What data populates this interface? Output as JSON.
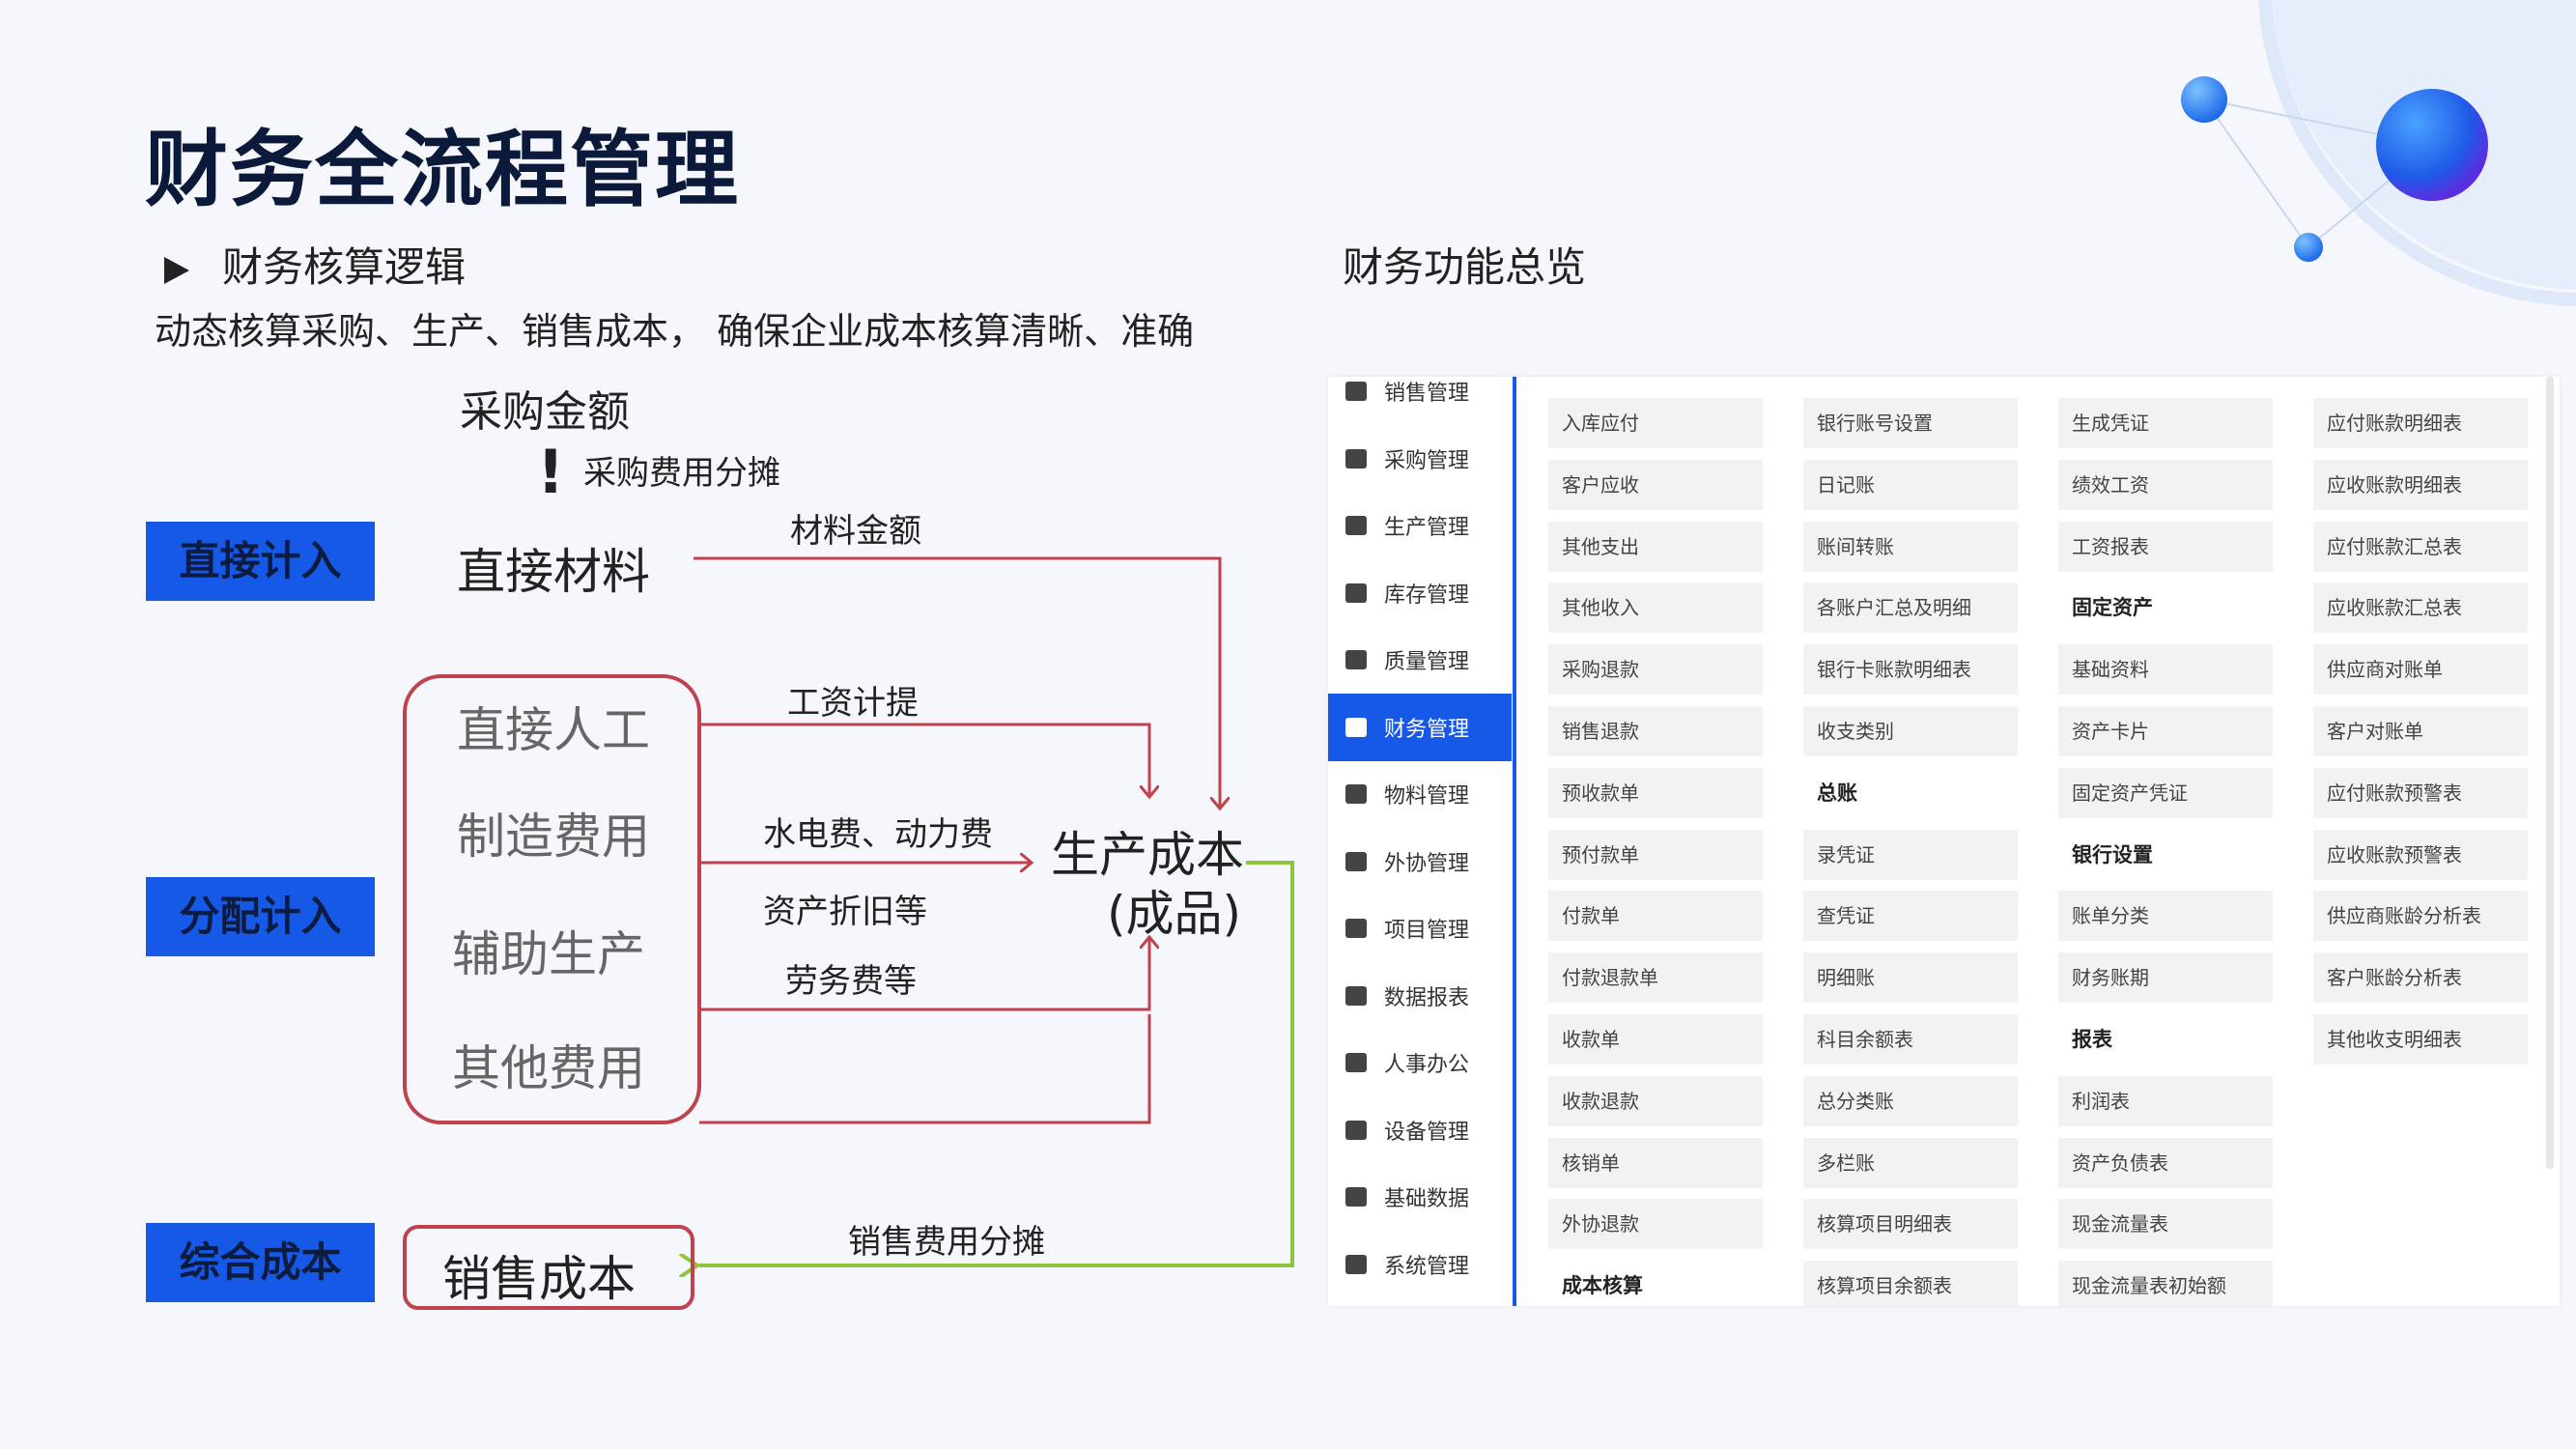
{
  "title": "财务全流程管理",
  "section_left": {
    "heading": "财务核算逻辑",
    "description": "动态核算采购、生产、销售成本， 确保企业成本核算清晰、准确"
  },
  "section_right": {
    "heading": "财务功能总览"
  },
  "diagram": {
    "tags": {
      "direct": "直接计入",
      "allocated": "分配计入",
      "comprehensive": "综合成本"
    },
    "purchase_amount": "采购金额",
    "exclamation": "!",
    "purchase_allocation": "采购费用分摊",
    "direct_material": "直接材料",
    "material_amount": "材料金额",
    "group_items": [
      "直接人工",
      "制造费用",
      "辅助生产",
      "其他费用"
    ],
    "wage": "工资计提",
    "utilities": "水电费、动力费",
    "depreciation": "资产折旧等",
    "labor": "劳务费等",
    "production_cost": "生产成本",
    "finished": "(成品)",
    "sales_allocation": "销售费用分摊",
    "sales_cost": "销售成本",
    "colors": {
      "red": "#c0424d",
      "green": "#8cc63f",
      "blue": "#1659e6"
    }
  },
  "ui_panel": {
    "sidebar": [
      {
        "label": "销售管理",
        "icon": "bar-chart-icon"
      },
      {
        "label": "采购管理",
        "icon": "edit-icon"
      },
      {
        "label": "生产管理",
        "icon": "cube-icon"
      },
      {
        "label": "库存管理",
        "icon": "box-icon"
      },
      {
        "label": "质量管理",
        "icon": "quality-icon"
      },
      {
        "label": "财务管理",
        "icon": "finance-icon",
        "active": true
      },
      {
        "label": "物料管理",
        "icon": "layers-icon"
      },
      {
        "label": "外协管理",
        "icon": "briefcase-icon"
      },
      {
        "label": "项目管理",
        "icon": "folder-icon"
      },
      {
        "label": "数据报表",
        "icon": "report-icon"
      },
      {
        "label": "人事办公",
        "icon": "person-icon"
      },
      {
        "label": "设备管理",
        "icon": "device-icon"
      },
      {
        "label": "基础数据",
        "icon": "database-icon"
      },
      {
        "label": "系统管理",
        "icon": "monitor-icon"
      }
    ],
    "columns": [
      [
        {
          "t": "入库应付"
        },
        {
          "t": "客户应收"
        },
        {
          "t": "其他支出"
        },
        {
          "t": "其他收入"
        },
        {
          "t": "采购退款"
        },
        {
          "t": "销售退款"
        },
        {
          "t": "预收款单"
        },
        {
          "t": "预付款单"
        },
        {
          "t": "付款单"
        },
        {
          "t": "付款退款单"
        },
        {
          "t": "收款单"
        },
        {
          "t": "收款退款"
        },
        {
          "t": "核销单"
        },
        {
          "t": "外协退款"
        },
        {
          "t": "成本核算",
          "h": true
        }
      ],
      [
        {
          "t": "银行账号设置"
        },
        {
          "t": "日记账"
        },
        {
          "t": "账间转账"
        },
        {
          "t": "各账户汇总及明细"
        },
        {
          "t": "银行卡账款明细表"
        },
        {
          "t": "收支类别"
        },
        {
          "t": "总账",
          "h": true
        },
        {
          "t": "录凭证"
        },
        {
          "t": "查凭证"
        },
        {
          "t": "明细账"
        },
        {
          "t": "科目余额表"
        },
        {
          "t": "总分类账"
        },
        {
          "t": "多栏账"
        },
        {
          "t": "核算项目明细表"
        },
        {
          "t": "核算项目余额表"
        }
      ],
      [
        {
          "t": "生成凭证"
        },
        {
          "t": "绩效工资"
        },
        {
          "t": "工资报表"
        },
        {
          "t": "固定资产",
          "h": true
        },
        {
          "t": "基础资料"
        },
        {
          "t": "资产卡片"
        },
        {
          "t": "固定资产凭证"
        },
        {
          "t": "银行设置",
          "h": true
        },
        {
          "t": "账单分类"
        },
        {
          "t": "财务账期"
        },
        {
          "t": "报表",
          "h": true
        },
        {
          "t": "利润表"
        },
        {
          "t": "资产负债表"
        },
        {
          "t": "现金流量表"
        },
        {
          "t": "现金流量表初始额"
        }
      ],
      [
        {
          "t": "应付账款明细表"
        },
        {
          "t": "应收账款明细表"
        },
        {
          "t": "应付账款汇总表"
        },
        {
          "t": "应收账款汇总表"
        },
        {
          "t": "供应商对账单"
        },
        {
          "t": "客户对账单"
        },
        {
          "t": "应付账款预警表"
        },
        {
          "t": "应收账款预警表"
        },
        {
          "t": "供应商账龄分析表"
        },
        {
          "t": "客户账龄分析表"
        },
        {
          "t": "其他收支明细表"
        }
      ]
    ]
  }
}
